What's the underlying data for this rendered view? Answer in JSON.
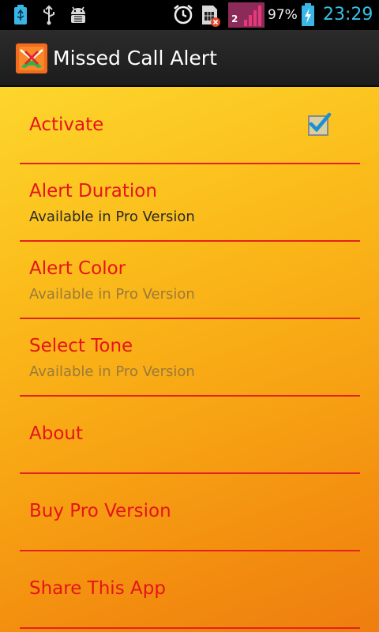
{
  "status_bar": {
    "battery_percent": "97%",
    "time": "23:29",
    "sim_slot": "2",
    "icons": [
      "usb-debug-icon",
      "usb-icon",
      "android-debug-icon",
      "alarm-icon",
      "sim-card-error-icon",
      "signal-icon",
      "battery-charging-icon"
    ],
    "time_color": "#37c1e8"
  },
  "app": {
    "title": "Missed Call Alert",
    "accent": "#e5141a"
  },
  "preferences": [
    {
      "title": "Activate",
      "checked": true
    },
    {
      "title": "Alert Duration",
      "summary": "Available in Pro Version",
      "enabled": true
    },
    {
      "title": "Alert Color",
      "summary": "Available in Pro Version",
      "enabled": false
    },
    {
      "title": "Select Tone",
      "summary": "Available in Pro Version",
      "enabled": false
    },
    {
      "title": "About"
    },
    {
      "title": "Buy Pro Version"
    },
    {
      "title": "Share This App"
    }
  ]
}
